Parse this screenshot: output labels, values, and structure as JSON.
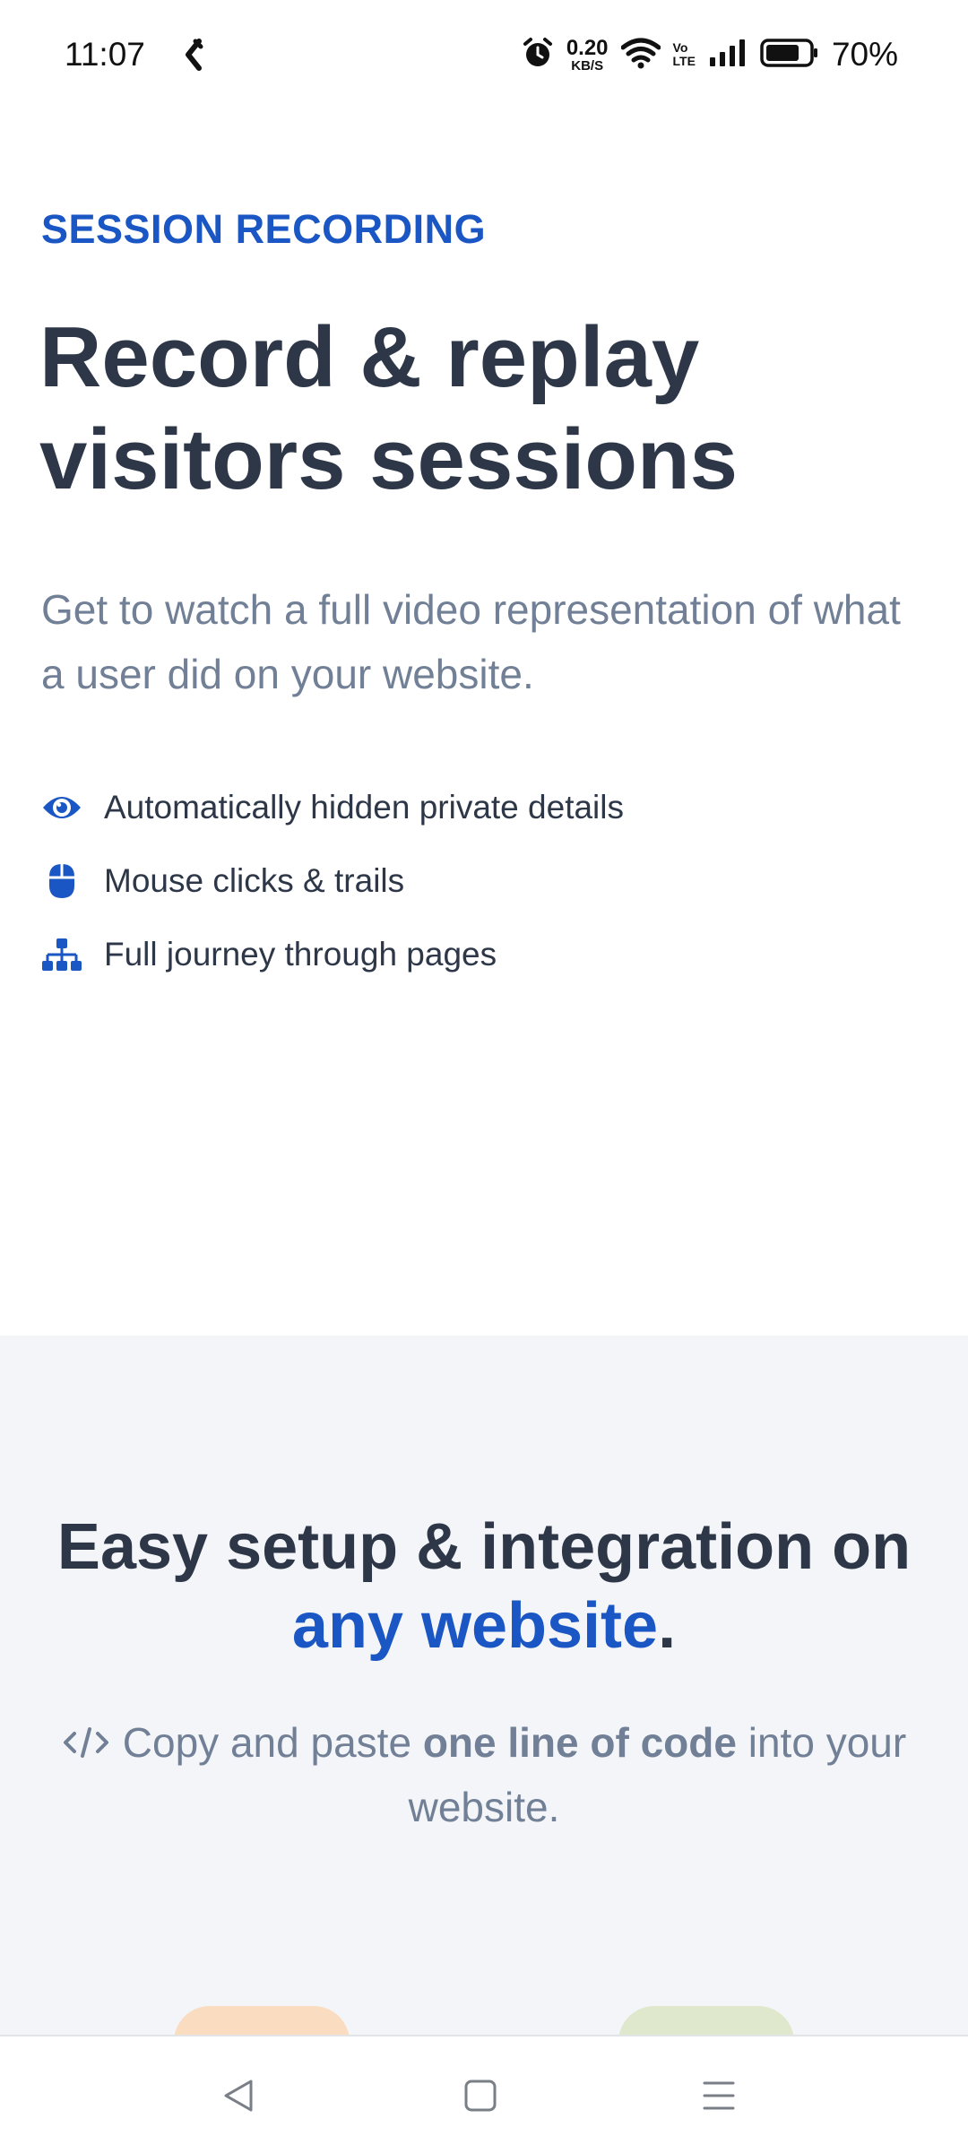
{
  "status_bar": {
    "time": "11:07",
    "speed_value": "0.20",
    "speed_unit": "KB/S",
    "volte_top": "Vo",
    "volte_bottom": "LTE",
    "battery": "70%"
  },
  "hero": {
    "eyebrow": "SESSION RECORDING",
    "title_line1": "Record & replay",
    "title_line2": "visitors sessions",
    "subtitle": "Get to watch a full video representation of what a user did on your website.",
    "features": [
      {
        "icon": "eye-icon",
        "label": "Automatically hidden private details"
      },
      {
        "icon": "mouse-icon",
        "label": "Mouse clicks & trails"
      },
      {
        "icon": "sitemap-icon",
        "label": "Full journey through pages"
      }
    ]
  },
  "setup": {
    "title_part1": "Easy setup & integration on",
    "title_accent": "any website",
    "title_end": ".",
    "sub_before": "Copy and paste",
    "sub_bold": "one line of code",
    "sub_after": "into your website."
  },
  "colors": {
    "accent": "#1a56c4",
    "heading": "#2d3748",
    "muted": "#718096",
    "section_bg": "#f3f5f8"
  }
}
